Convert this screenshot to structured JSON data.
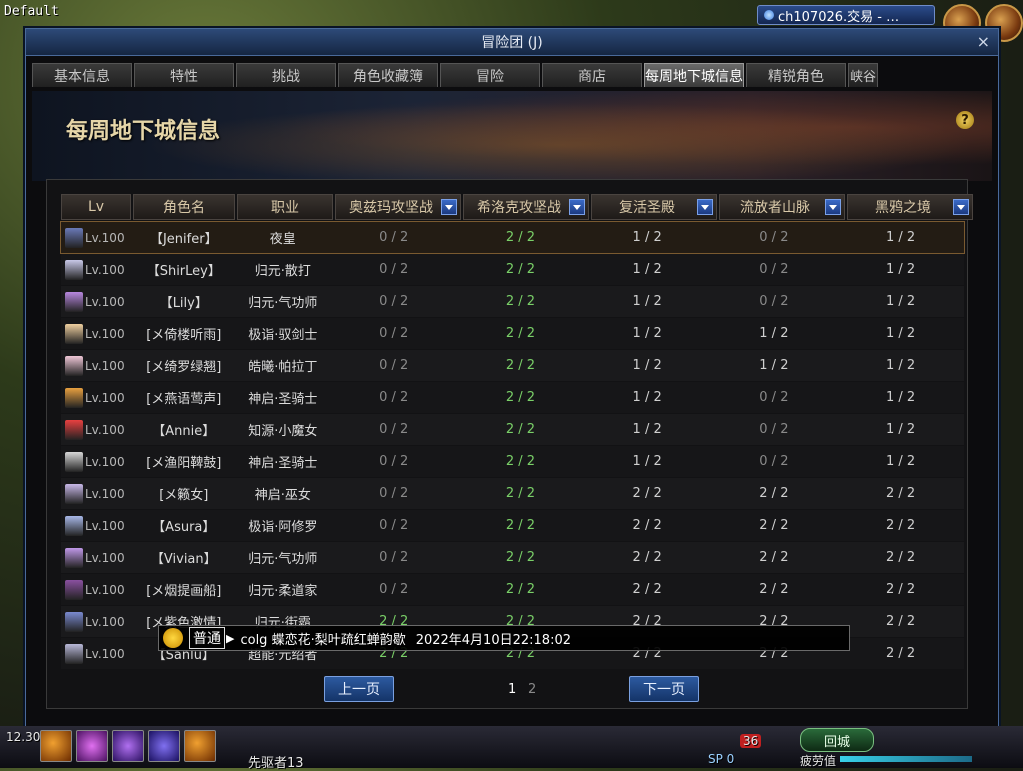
{
  "corner_title": "Default",
  "channel_text": "ch107026.交易 - …",
  "window": {
    "title": "冒险团 (J)",
    "close": "×",
    "tabs": [
      {
        "label": "基本信息",
        "active": false
      },
      {
        "label": "特性",
        "active": false
      },
      {
        "label": "挑战",
        "active": false
      },
      {
        "label": "角色收藏簿",
        "active": false
      },
      {
        "label": "冒险",
        "active": false
      },
      {
        "label": "商店",
        "active": false
      },
      {
        "label": "每周地下城信息",
        "active": true
      },
      {
        "label": "精锐角色",
        "active": false
      },
      {
        "label": "峡谷",
        "active": false
      }
    ],
    "banner_title": "每周地下城信息",
    "help": "?"
  },
  "table": {
    "headers": [
      {
        "label": "Lv",
        "dropdown": false
      },
      {
        "label": "角色名",
        "dropdown": false
      },
      {
        "label": "职业",
        "dropdown": false
      },
      {
        "label": "奥兹玛攻坚战",
        "dropdown": true
      },
      {
        "label": "希洛克攻坚战",
        "dropdown": true
      },
      {
        "label": "复活圣殿",
        "dropdown": true
      },
      {
        "label": "流放者山脉",
        "dropdown": true
      },
      {
        "label": "黑鸦之境",
        "dropdown": true
      }
    ],
    "rows": [
      {
        "lv": "Lv.100",
        "name": "【Jenifer】",
        "job": "夜皇",
        "d": [
          "0 / 2",
          "2 / 2",
          "1 / 2",
          "0 / 2",
          "1 / 2"
        ],
        "avatar": "#6a7ab8",
        "selected": true
      },
      {
        "lv": "Lv.100",
        "name": "【ShirLey】",
        "job": "归元·散打",
        "d": [
          "0 / 2",
          "2 / 2",
          "1 / 2",
          "0 / 2",
          "1 / 2"
        ],
        "avatar": "#c8c8e8"
      },
      {
        "lv": "Lv.100",
        "name": "【Lily】",
        "job": "归元·气功师",
        "d": [
          "0 / 2",
          "2 / 2",
          "1 / 2",
          "0 / 2",
          "1 / 2"
        ],
        "avatar": "#b888e0"
      },
      {
        "lv": "Lv.100",
        "name": "[メ倚楼听雨]",
        "job": "极诣·驭剑士",
        "d": [
          "0 / 2",
          "2 / 2",
          "1 / 2",
          "1 / 2",
          "1 / 2"
        ],
        "avatar": "#f0d0a0"
      },
      {
        "lv": "Lv.100",
        "name": "[メ绮罗绿翘]",
        "job": "皓曦·帕拉丁",
        "d": [
          "0 / 2",
          "2 / 2",
          "1 / 2",
          "1 / 2",
          "1 / 2"
        ],
        "avatar": "#f0c8d8"
      },
      {
        "lv": "Lv.100",
        "name": "[メ燕语莺声]",
        "job": "神启·圣骑士",
        "d": [
          "0 / 2",
          "2 / 2",
          "1 / 2",
          "0 / 2",
          "1 / 2"
        ],
        "avatar": "#e8a040"
      },
      {
        "lv": "Lv.100",
        "name": "【Annie】",
        "job": "知源·小魔女",
        "d": [
          "0 / 2",
          "2 / 2",
          "1 / 2",
          "0 / 2",
          "1 / 2"
        ],
        "avatar": "#e84040"
      },
      {
        "lv": "Lv.100",
        "name": "[メ渔阳鞞鼓]",
        "job": "神启·圣骑士",
        "d": [
          "0 / 2",
          "2 / 2",
          "1 / 2",
          "0 / 2",
          "1 / 2"
        ],
        "avatar": "#d8d8d8"
      },
      {
        "lv": "Lv.100",
        "name": "[メ籁女]",
        "job": "神启·巫女",
        "d": [
          "0 / 2",
          "2 / 2",
          "2 / 2",
          "2 / 2",
          "2 / 2"
        ],
        "avatar": "#c8b8e8"
      },
      {
        "lv": "Lv.100",
        "name": "【Asura】",
        "job": "极诣·阿修罗",
        "d": [
          "0 / 2",
          "2 / 2",
          "2 / 2",
          "2 / 2",
          "2 / 2"
        ],
        "avatar": "#a8b8e8"
      },
      {
        "lv": "Lv.100",
        "name": "【Vivian】",
        "job": "归元·气功师",
        "d": [
          "0 / 2",
          "2 / 2",
          "2 / 2",
          "2 / 2",
          "2 / 2"
        ],
        "avatar": "#c098e8"
      },
      {
        "lv": "Lv.100",
        "name": "[メ烟提画船]",
        "job": "归元·柔道家",
        "d": [
          "0 / 2",
          "2 / 2",
          "2 / 2",
          "2 / 2",
          "2 / 2"
        ],
        "avatar": "#8a50a0"
      },
      {
        "lv": "Lv.100",
        "name": "[メ紫色激情]",
        "job": "归元·街霸",
        "d": [
          "2 / 2",
          "2 / 2",
          "2 / 2",
          "2 / 2",
          "2 / 2"
        ],
        "avatar": "#7a8ad0"
      },
      {
        "lv": "Lv.100",
        "name": "【Sanlu】",
        "job": "超能·元绍者",
        "d": [
          "2 / 2",
          "2 / 2",
          "2 / 2",
          "2 / 2",
          "2 / 2"
        ],
        "avatar": "#b8b8d8"
      }
    ]
  },
  "chat": {
    "channel": "普通",
    "arrow": "▶",
    "message": "colg 蝶恋花·梨叶疏红蝉韵歇",
    "time": "2022年4月10日22:18:02"
  },
  "pager": {
    "prev": "上一页",
    "next": "下一页",
    "pages": [
      "1",
      "2"
    ],
    "current": "1"
  },
  "bottom": {
    "level_badge": "12.30",
    "char_label": "先驱者13",
    "sp": "SP 0",
    "count": "36",
    "town": "回城",
    "fatigue": "疲劳值"
  },
  "colors": {
    "accent": "#2d5aa0",
    "cleared": "#7ad068",
    "pending": "#8a8a8a"
  }
}
